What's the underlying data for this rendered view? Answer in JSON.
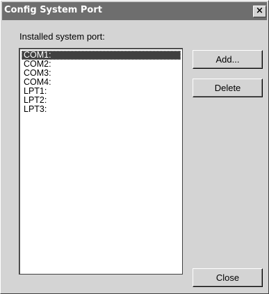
{
  "window": {
    "title": "Config System Port",
    "close_glyph": "×"
  },
  "label": "Installed system port:",
  "ports": [
    {
      "name": "COM1:",
      "selected": true
    },
    {
      "name": "COM2:",
      "selected": false
    },
    {
      "name": "COM3:",
      "selected": false
    },
    {
      "name": "COM4:",
      "selected": false
    },
    {
      "name": "LPT1:",
      "selected": false
    },
    {
      "name": "LPT2:",
      "selected": false
    },
    {
      "name": "LPT3:",
      "selected": false
    }
  ],
  "buttons": {
    "add": "Add...",
    "delete": "Delete",
    "close": "Close"
  },
  "colors": {
    "titlebar": "#6e6e6e",
    "face": "#d4d4d4",
    "selection": "#404040"
  }
}
